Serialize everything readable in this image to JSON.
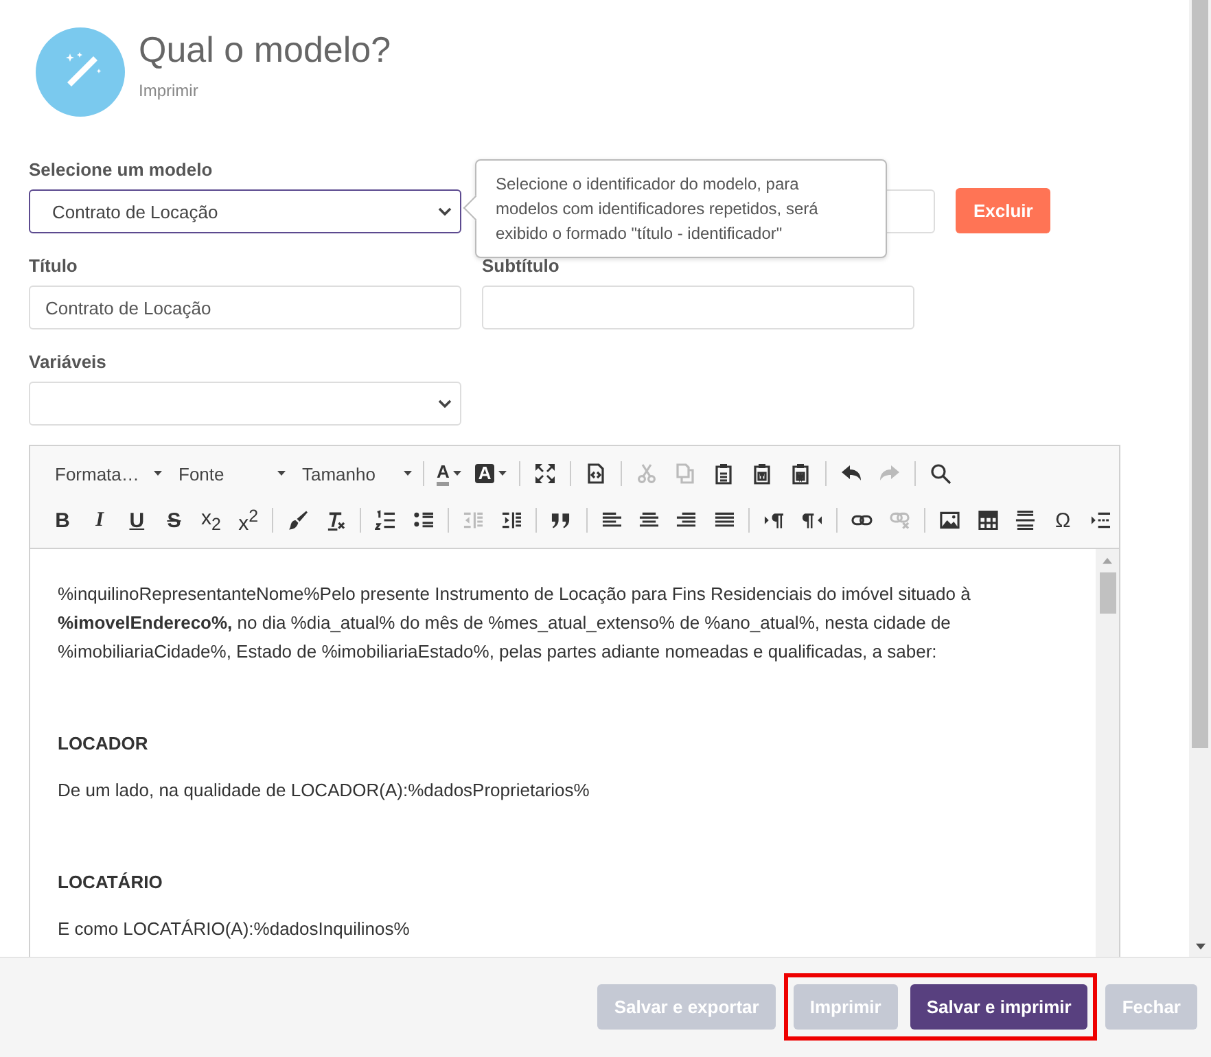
{
  "header": {
    "title": "Qual o modelo?",
    "subtitle": "Imprimir"
  },
  "model_select": {
    "label": "Selecione um modelo",
    "value": "Contrato de Locação",
    "focused": true
  },
  "delete_button": {
    "label": "Excluir"
  },
  "tooltip": {
    "text": "Selecione o identificador do modelo, para modelos com identificadores repetidos, será exibido o formado \"título - identificador\""
  },
  "title_field": {
    "label": "Título",
    "value": "Contrato de Locação"
  },
  "subtitle_field": {
    "label": "Subtítulo"
  },
  "variables_select": {
    "label": "Variáveis"
  },
  "toolbar_rows": [
    [
      {
        "kind": "dropdown",
        "text": "Formata…"
      },
      {
        "kind": "dropdown",
        "text": "Fonte"
      },
      {
        "kind": "dropdown",
        "text": "Tamanho"
      },
      {
        "kind": "sep"
      },
      {
        "kind": "text-color",
        "text": "A"
      },
      {
        "kind": "bg-color",
        "text": "A"
      },
      {
        "kind": "sep"
      },
      {
        "kind": "maximize",
        "disabled": false
      },
      {
        "kind": "sep"
      },
      {
        "kind": "source",
        "disabled": false
      },
      {
        "kind": "sep"
      },
      {
        "kind": "cut",
        "disabled": true
      },
      {
        "kind": "copy",
        "disabled": true
      },
      {
        "kind": "paste",
        "disabled": false
      },
      {
        "kind": "paste-text",
        "disabled": false
      },
      {
        "kind": "paste-word",
        "disabled": false
      },
      {
        "kind": "sep"
      },
      {
        "kind": "undo",
        "disabled": false
      },
      {
        "kind": "redo",
        "disabled": true
      },
      {
        "kind": "sep"
      },
      {
        "kind": "find",
        "disabled": false
      }
    ],
    [
      {
        "kind": "bold",
        "text": "B"
      },
      {
        "kind": "italic",
        "text": "I"
      },
      {
        "kind": "underline",
        "text": "U"
      },
      {
        "kind": "strike",
        "text": "S"
      },
      {
        "kind": "subscript",
        "text": "x$_{2}$"
      },
      {
        "kind": "superscript",
        "text": "x$^{2}$"
      },
      {
        "kind": "sep"
      },
      {
        "kind": "brush",
        "disabled": false
      },
      {
        "kind": "clear-format",
        "disabled": false
      },
      {
        "kind": "sep"
      },
      {
        "kind": "numbered-list",
        "disabled": false
      },
      {
        "kind": "bullet-list",
        "disabled": false
      },
      {
        "kind": "sep"
      },
      {
        "kind": "outdent",
        "disabled": true
      },
      {
        "kind": "indent",
        "disabled": false
      },
      {
        "kind": "sep"
      },
      {
        "kind": "quote",
        "disabled": false
      },
      {
        "kind": "sep"
      },
      {
        "kind": "align-left",
        "disabled": false
      },
      {
        "kind": "align-center",
        "disabled": false
      },
      {
        "kind": "align-right",
        "disabled": false
      },
      {
        "kind": "align-justify",
        "disabled": false
      },
      {
        "kind": "sep"
      },
      {
        "kind": "ltr",
        "disabled": false
      },
      {
        "kind": "rtl",
        "disabled": false
      },
      {
        "kind": "sep"
      },
      {
        "kind": "link",
        "disabled": false
      },
      {
        "kind": "unlink",
        "disabled": true
      },
      {
        "kind": "sep"
      },
      {
        "kind": "image",
        "disabled": false
      },
      {
        "kind": "table",
        "disabled": false
      },
      {
        "kind": "hr",
        "disabled": false
      },
      {
        "kind": "special-char",
        "text": "Ω"
      },
      {
        "kind": "page-break",
        "disabled": false
      }
    ]
  ],
  "document": [
    {
      "kind": "paragraph",
      "text": "%inquilinoRepresentanteNome%Pelo presente Instrumento de Locação para Fins Residenciais do imóvel situado à **%imovelEndereco%,** no dia %dia_atual% do mês de %mes_atual_extenso% de %ano_atual%, nesta cidade de %imobiliariaCidade%, Estado de %imobiliariaEstado%, pelas partes adiante nomeadas e qualificadas, a saber:"
    },
    {
      "kind": "heading",
      "text": "LOCADOR"
    },
    {
      "kind": "paragraph",
      "text": "De um lado, na qualidade de LOCADOR(A):%dadosProprietarios%"
    },
    {
      "kind": "heading",
      "text": "LOCATÁRIO"
    },
    {
      "kind": "paragraph",
      "text": "E como LOCATÁRIO(A):%dadosInquilinos%"
    }
  ],
  "footer_buttons": [
    {
      "label": "Salvar e exportar",
      "kind": "secondary",
      "highlighted": false
    },
    {
      "label": "Imprimir",
      "kind": "secondary",
      "highlighted": true
    },
    {
      "label": "Salvar e imprimir",
      "kind": "primary",
      "highlighted": true
    },
    {
      "label": "Fechar",
      "kind": "secondary",
      "highlighted": false
    }
  ]
}
